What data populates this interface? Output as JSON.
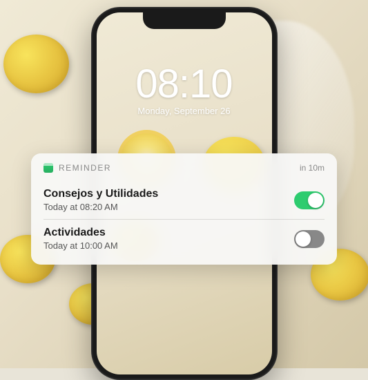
{
  "lockscreen": {
    "time": "08:10",
    "date": "Monday, September 26"
  },
  "notification": {
    "app_label": "REMINDER",
    "time_remaining": "in 10m",
    "items": [
      {
        "title": "Consejos y Utilidades",
        "subtitle": "Today at 08:20 AM",
        "enabled": true
      },
      {
        "title": "Actividades",
        "subtitle": "Today at 10:00 AM",
        "enabled": false
      }
    ]
  }
}
